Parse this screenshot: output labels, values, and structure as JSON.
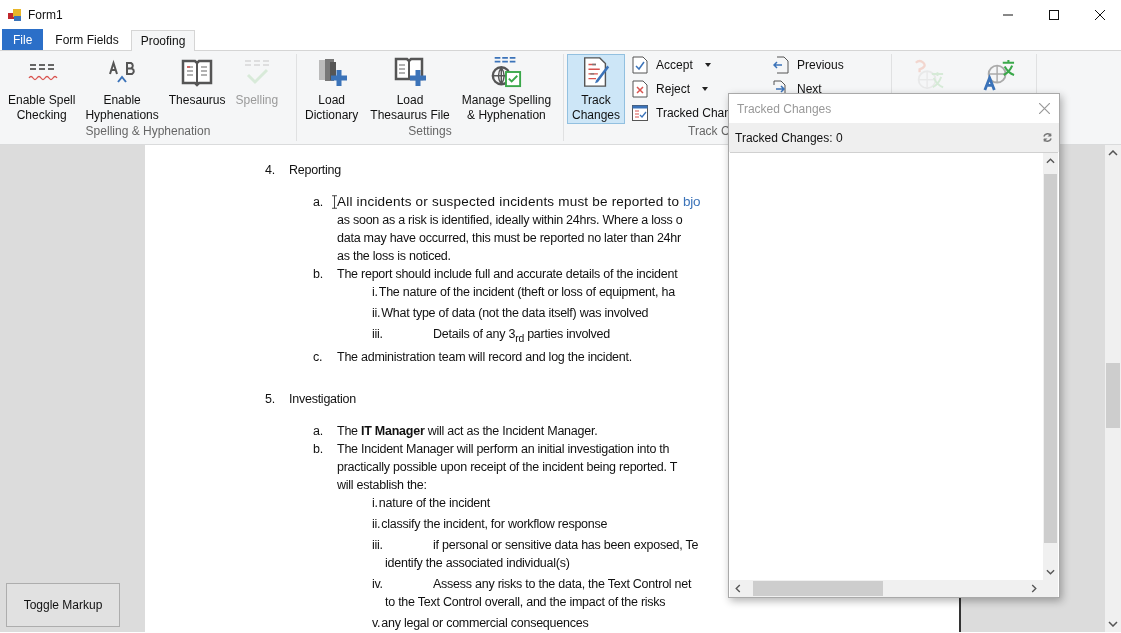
{
  "window": {
    "title": "Form1"
  },
  "tabs": [
    {
      "label": "File",
      "kind": "menu",
      "selected": false
    },
    {
      "label": "Form Fields",
      "kind": "tab",
      "selected": false
    },
    {
      "label": "Proofing",
      "kind": "tab",
      "selected": true
    }
  ],
  "ribbon": {
    "groups": [
      {
        "label": "Spelling & Hyphenation",
        "buttons": [
          {
            "kind": "large",
            "label": "Enable Spell\nChecking",
            "disabled": false,
            "selected": false
          },
          {
            "kind": "large",
            "label": "Enable\nHyphenations",
            "disabled": false,
            "selected": false
          },
          {
            "kind": "large",
            "label": "Thesaurus",
            "disabled": false,
            "selected": false
          },
          {
            "kind": "large",
            "label": "Spelling",
            "disabled": true,
            "selected": false
          }
        ]
      },
      {
        "label": "Settings",
        "buttons": [
          {
            "kind": "large",
            "label": "Load\nDictionary",
            "disabled": false,
            "selected": false
          },
          {
            "kind": "large",
            "label": "Load\nThesaurus File",
            "disabled": false,
            "selected": false
          },
          {
            "kind": "large",
            "label": "Manage Spelling\n& Hyphenation",
            "disabled": false,
            "selected": false
          }
        ]
      },
      {
        "label": "Track C",
        "buttons": [
          {
            "kind": "large",
            "label": "Track\nChanges",
            "disabled": false,
            "selected": true
          },
          {
            "kind": "small",
            "label": "Accept",
            "dropdown": true
          },
          {
            "kind": "small",
            "label": "Reject",
            "dropdown": true
          },
          {
            "kind": "small",
            "label": "Tracked Chan",
            "dropdown": false
          },
          {
            "kind": "small",
            "label": "Previous",
            "dropdown": false
          },
          {
            "kind": "small",
            "label": "Next",
            "dropdown": false
          }
        ]
      },
      {
        "buttons": [
          {
            "kind": "large",
            "disabled": true,
            "selected": false
          },
          {
            "kind": "large",
            "disabled": false,
            "selected": false
          }
        ]
      }
    ]
  },
  "document": {
    "sections": [
      {
        "number": "4.",
        "heading": "Reporting",
        "items": [
          {
            "marker": "a.",
            "lines": [
              "All incidents or suspected incidents must be reported to ",
              "as soon as a risk is identified, ideally within 24hrs. Where a loss o",
              "data may have occurred, this must be reported no later than 24hr",
              "as the loss is noticed."
            ],
            "link": "bjo"
          },
          {
            "marker": "b.",
            "lines": [
              "The report should include full and accurate details of the incident"
            ],
            "subitems": [
              {
                "marker": "i.",
                "kind": "inline",
                "lines": [
                  "The nature of the incident (theft or loss of equipment, ha"
                ]
              },
              {
                "marker": "ii.",
                "kind": "inline",
                "lines": [
                  "What type of data (not the data itself) was involved"
                ]
              },
              {
                "marker": "iii.",
                "kind": "tab",
                "lines": [
                  "Details of any 3$_{rd}$ parties involved"
                ]
              }
            ]
          },
          {
            "marker": "c.",
            "lines": [
              "The administration team will record and log the incident."
            ]
          }
        ]
      },
      {
        "number": "5.",
        "heading": "Investigation",
        "items": [
          {
            "marker": "a.",
            "lines": [
              "The **IT Manager** will act as the Incident Manager."
            ]
          },
          {
            "marker": "b.",
            "lines": [
              "The Incident Manager will perform an initial investigation into th",
              "practically possible upon receipt of the incident being reported. T",
              "will establish the:"
            ],
            "subitems": [
              {
                "marker": "i.",
                "kind": "inline",
                "lines": [
                  "nature of the incident"
                ]
              },
              {
                "marker": "ii.",
                "kind": "inline",
                "lines": [
                  "classify the incident, for workflow response"
                ]
              },
              {
                "marker": "iii.",
                "kind": "tab",
                "lines": [
                  "if personal or sensitive data has been exposed, Te",
                  "identify the associated individual(s)"
                ]
              },
              {
                "marker": "iv.",
                "kind": "tab",
                "lines": [
                  "Assess any risks to the data, the Text Control net",
                  "to the Text Control overall, and the impact of the risks"
                ]
              },
              {
                "marker": "v.",
                "kind": "inline",
                "lines": [
                  "any legal or commercial consequences"
                ]
              }
            ]
          }
        ]
      }
    ]
  },
  "toggle_button": {
    "label": "Toggle Markup"
  },
  "tracked_changes_panel": {
    "title": "Tracked Changes",
    "count_label": "Tracked Changes: 0"
  }
}
